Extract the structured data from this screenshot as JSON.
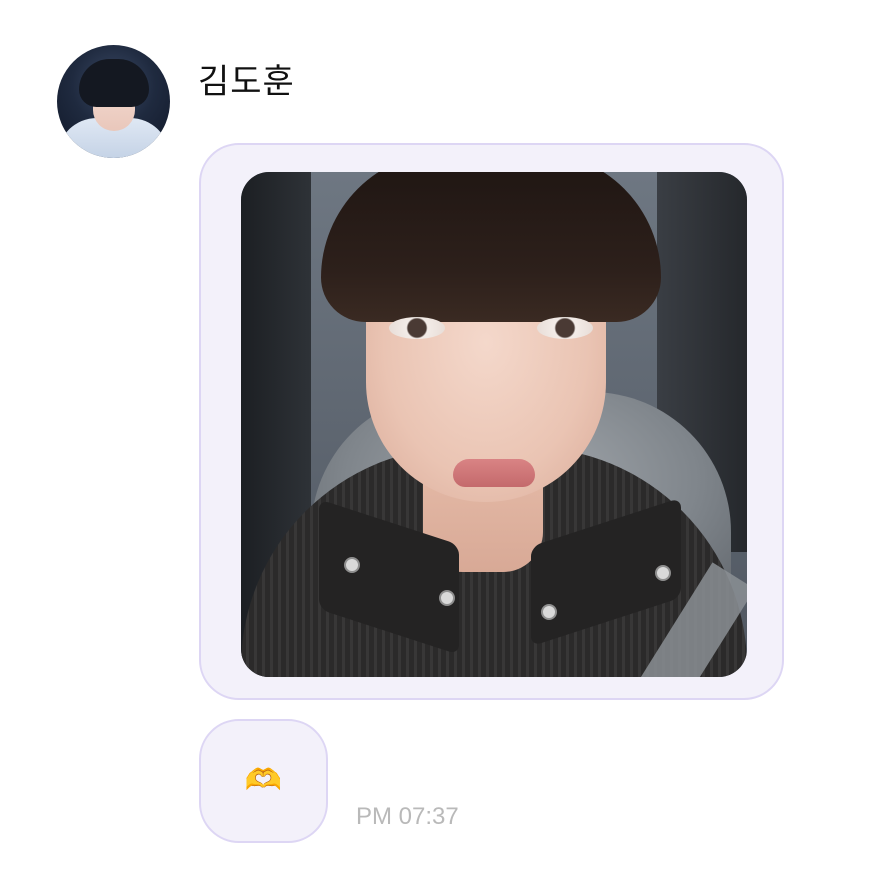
{
  "message": {
    "sender_name": "김도훈",
    "avatar_icon": "profile-photo",
    "photo_icon": "selfie-photo",
    "emoji": "🫶",
    "emoji_icon": "heart-hands-emoji",
    "timestamp": "PM 07:37"
  },
  "colors": {
    "bubble_background": "#f3f1fa",
    "bubble_border": "#ddd6f4",
    "timestamp_text": "#b9b9b9",
    "name_text": "#111111"
  }
}
